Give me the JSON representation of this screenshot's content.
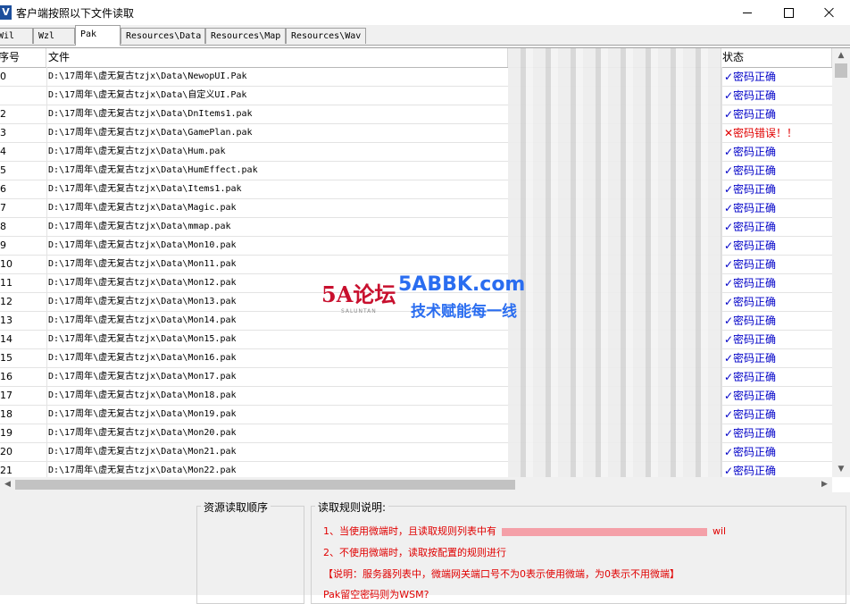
{
  "window": {
    "title": "客户端按照以下文件读取",
    "app_icon_letter": "V",
    "colors": {
      "ok_text": "#0000c8",
      "error_text": "#e00000",
      "rule_text": "#e00000"
    }
  },
  "tabs": [
    {
      "label": "Wil",
      "active": false
    },
    {
      "label": "Wzl",
      "active": false
    },
    {
      "label": "Pak",
      "active": true
    },
    {
      "label": "Resources\\Data",
      "active": false
    },
    {
      "label": "Resources\\Map",
      "active": false
    },
    {
      "label": "Resources\\Wav",
      "active": false
    }
  ],
  "grid": {
    "columns": {
      "index": "序号",
      "file": "文件",
      "status": "状态"
    },
    "rows": [
      {
        "index": "0",
        "file": "D:\\17周年\\虚无复古tzjx\\Data\\NewopUI.Pak",
        "status": "✓密码正确",
        "ok": true
      },
      {
        "index": "",
        "file": "D:\\17周年\\虚无复古tzjx\\Data\\自定义UI.Pak",
        "status": "✓密码正确",
        "ok": true
      },
      {
        "index": "2",
        "file": "D:\\17周年\\虚无复古tzjx\\Data\\DnItems1.pak",
        "status": "✓密码正确",
        "ok": true
      },
      {
        "index": "3",
        "file": "D:\\17周年\\虚无复古tzjx\\Data\\GamePlan.pak",
        "status": "✕密码错误！！",
        "ok": false
      },
      {
        "index": "4",
        "file": "D:\\17周年\\虚无复古tzjx\\Data\\Hum.pak",
        "status": "✓密码正确",
        "ok": true
      },
      {
        "index": "5",
        "file": "D:\\17周年\\虚无复古tzjx\\Data\\HumEffect.pak",
        "status": "✓密码正确",
        "ok": true
      },
      {
        "index": "6",
        "file": "D:\\17周年\\虚无复古tzjx\\Data\\Items1.pak",
        "status": "✓密码正确",
        "ok": true
      },
      {
        "index": "7",
        "file": "D:\\17周年\\虚无复古tzjx\\Data\\Magic.pak",
        "status": "✓密码正确",
        "ok": true
      },
      {
        "index": "8",
        "file": "D:\\17周年\\虚无复古tzjx\\Data\\mmap.pak",
        "status": "✓密码正确",
        "ok": true
      },
      {
        "index": "9",
        "file": "D:\\17周年\\虚无复古tzjx\\Data\\Mon10.pak",
        "status": "✓密码正确",
        "ok": true
      },
      {
        "index": "10",
        "file": "D:\\17周年\\虚无复古tzjx\\Data\\Mon11.pak",
        "status": "✓密码正确",
        "ok": true
      },
      {
        "index": "11",
        "file": "D:\\17周年\\虚无复古tzjx\\Data\\Mon12.pak",
        "status": "✓密码正确",
        "ok": true
      },
      {
        "index": "12",
        "file": "D:\\17周年\\虚无复古tzjx\\Data\\Mon13.pak",
        "status": "✓密码正确",
        "ok": true
      },
      {
        "index": "13",
        "file": "D:\\17周年\\虚无复古tzjx\\Data\\Mon14.pak",
        "status": "✓密码正确",
        "ok": true
      },
      {
        "index": "14",
        "file": "D:\\17周年\\虚无复古tzjx\\Data\\Mon15.pak",
        "status": "✓密码正确",
        "ok": true
      },
      {
        "index": "15",
        "file": "D:\\17周年\\虚无复古tzjx\\Data\\Mon16.pak",
        "status": "✓密码正确",
        "ok": true
      },
      {
        "index": "16",
        "file": "D:\\17周年\\虚无复古tzjx\\Data\\Mon17.pak",
        "status": "✓密码正确",
        "ok": true
      },
      {
        "index": "17",
        "file": "D:\\17周年\\虚无复古tzjx\\Data\\Mon18.pak",
        "status": "✓密码正确",
        "ok": true
      },
      {
        "index": "18",
        "file": "D:\\17周年\\虚无复古tzjx\\Data\\Mon19.pak",
        "status": "✓密码正确",
        "ok": true
      },
      {
        "index": "19",
        "file": "D:\\17周年\\虚无复古tzjx\\Data\\Mon20.pak",
        "status": "✓密码正确",
        "ok": true
      },
      {
        "index": "20",
        "file": "D:\\17周年\\虚无复古tzjx\\Data\\Mon21.pak",
        "status": "✓密码正确",
        "ok": true
      },
      {
        "index": "21",
        "file": "D:\\17周年\\虚无复古tzjx\\Data\\Mon22.pak",
        "status": "✓密码正确",
        "ok": true
      }
    ]
  },
  "bottom": {
    "resource_order_title": "资源读取顺序",
    "rules_title": "读取规则说明:",
    "rule1": "1、当使用微端时，且读取规则列表中有",
    "rule1_tail": "wil",
    "rule2": "2、不使用微端时，读取按配置的规则进行",
    "note": "【说明：服务器列表中，微端网关端口号不为0表示使用微端，为0表示不用微端】",
    "cut_line": "Pak留空密码则为WSM?"
  },
  "watermark": {
    "logo_text": "5A论坛",
    "logo_sub": "SALUNTAN",
    "site": "5ABBK.com",
    "slogan": "技术赋能每一线"
  }
}
